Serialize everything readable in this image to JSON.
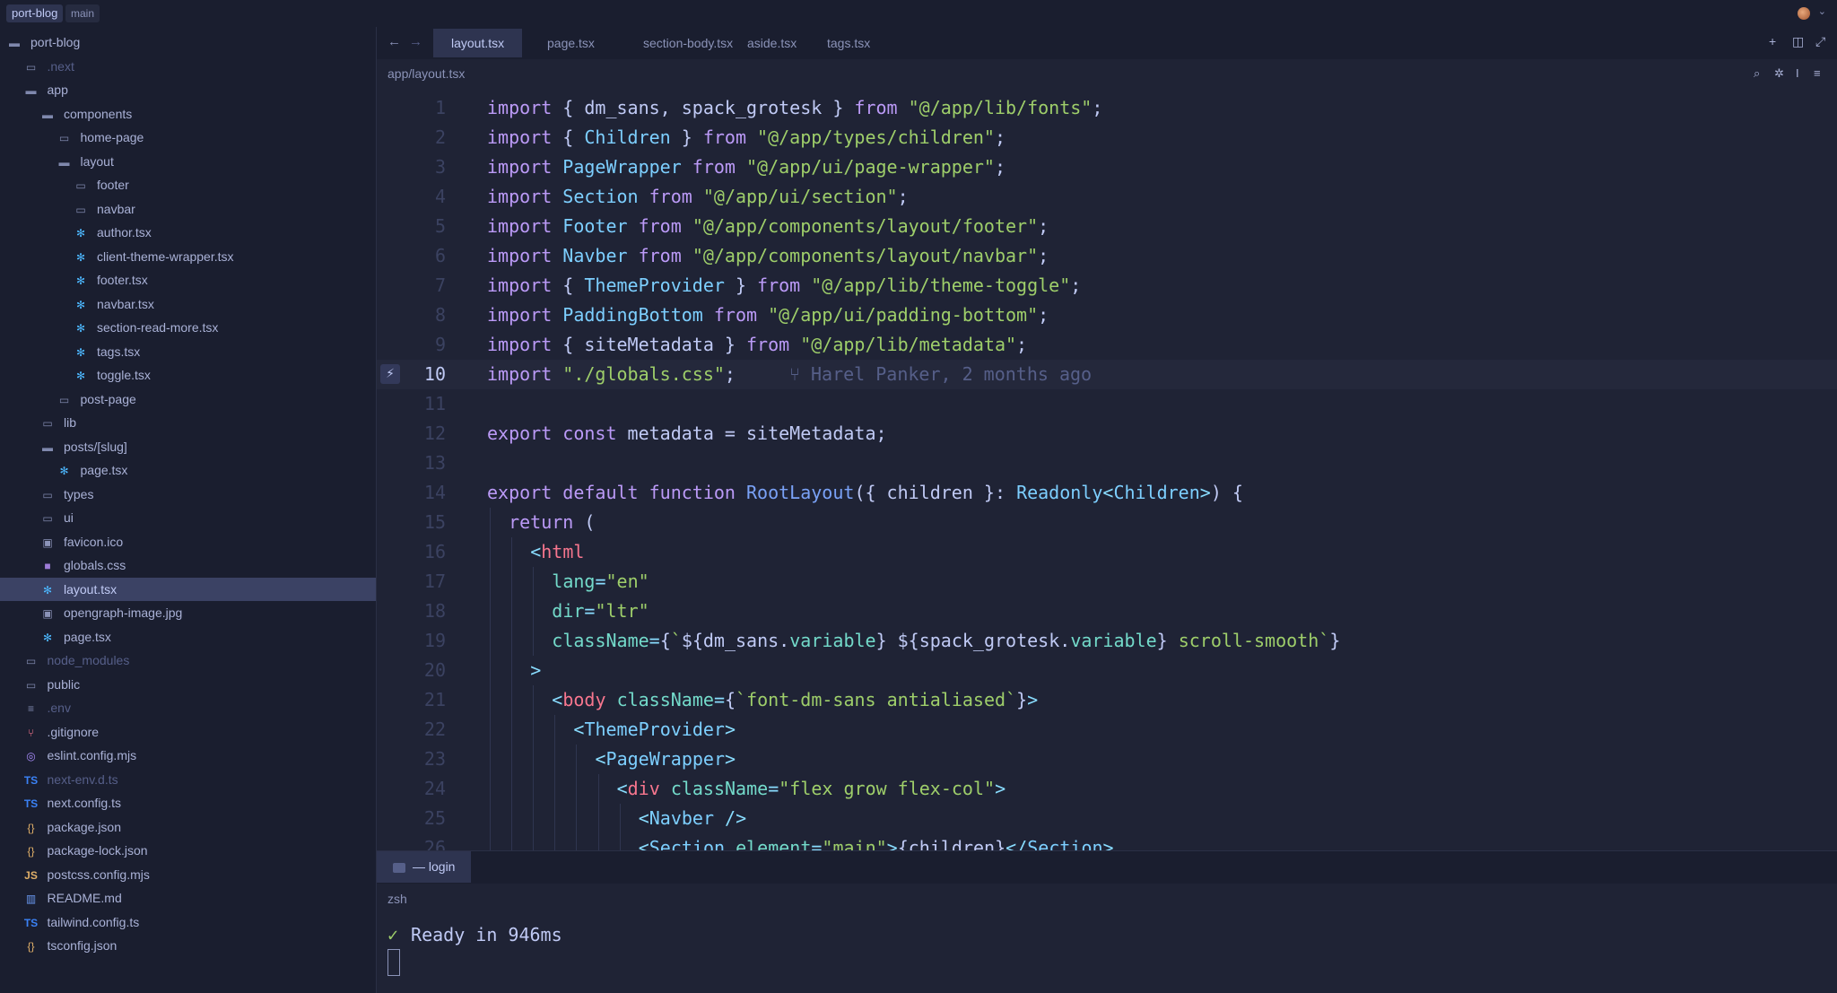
{
  "titlebar": {
    "project": "port-blog",
    "branch": "main"
  },
  "sidebar": {
    "items": [
      {
        "label": "port-blog",
        "icon": "folder-open-icon",
        "depth": 0,
        "muted": false
      },
      {
        "label": ".next",
        "icon": "folder-icon",
        "depth": 1,
        "muted": true
      },
      {
        "label": "app",
        "icon": "folder-open-icon",
        "depth": 1,
        "muted": false
      },
      {
        "label": "components",
        "icon": "folder-open-icon",
        "depth": 2,
        "muted": false
      },
      {
        "label": "home-page",
        "icon": "folder-icon",
        "depth": 3,
        "muted": false
      },
      {
        "label": "layout",
        "icon": "folder-open-icon",
        "depth": 3,
        "muted": false
      },
      {
        "label": "footer",
        "icon": "folder-icon",
        "depth": 4,
        "muted": false
      },
      {
        "label": "navbar",
        "icon": "folder-icon",
        "depth": 4,
        "muted": false
      },
      {
        "label": "author.tsx",
        "icon": "react-icon",
        "depth": 4,
        "muted": false
      },
      {
        "label": "client-theme-wrapper.tsx",
        "icon": "react-icon",
        "depth": 4,
        "muted": false
      },
      {
        "label": "footer.tsx",
        "icon": "react-icon",
        "depth": 4,
        "muted": false
      },
      {
        "label": "navbar.tsx",
        "icon": "react-icon",
        "depth": 4,
        "muted": false
      },
      {
        "label": "section-read-more.tsx",
        "icon": "react-icon",
        "depth": 4,
        "muted": false
      },
      {
        "label": "tags.tsx",
        "icon": "react-icon",
        "depth": 4,
        "muted": false
      },
      {
        "label": "toggle.tsx",
        "icon": "react-icon",
        "depth": 4,
        "muted": false
      },
      {
        "label": "post-page",
        "icon": "folder-icon",
        "depth": 3,
        "muted": false
      },
      {
        "label": "lib",
        "icon": "folder-icon",
        "depth": 2,
        "muted": false
      },
      {
        "label": "posts/[slug]",
        "icon": "folder-open-icon",
        "depth": 2,
        "muted": false
      },
      {
        "label": "page.tsx",
        "icon": "react-icon",
        "depth": 3,
        "muted": false
      },
      {
        "label": "types",
        "icon": "folder-icon",
        "depth": 2,
        "muted": false
      },
      {
        "label": "ui",
        "icon": "folder-icon",
        "depth": 2,
        "muted": false
      },
      {
        "label": "favicon.ico",
        "icon": "image-icon",
        "depth": 2,
        "muted": false
      },
      {
        "label": "globals.css",
        "icon": "css-icon",
        "depth": 2,
        "muted": false
      },
      {
        "label": "layout.tsx",
        "icon": "react-icon",
        "depth": 2,
        "muted": false,
        "selected": true
      },
      {
        "label": "opengraph-image.jpg",
        "icon": "image-icon",
        "depth": 2,
        "muted": false
      },
      {
        "label": "page.tsx",
        "icon": "react-icon",
        "depth": 2,
        "muted": false
      },
      {
        "label": "node_modules",
        "icon": "folder-icon",
        "depth": 1,
        "muted": true
      },
      {
        "label": "public",
        "icon": "folder-icon",
        "depth": 1,
        "muted": false
      },
      {
        "label": ".env",
        "icon": "env-icon",
        "depth": 1,
        "muted": true
      },
      {
        "label": ".gitignore",
        "icon": "git-icon",
        "depth": 1,
        "muted": false
      },
      {
        "label": "eslint.config.mjs",
        "icon": "eslint-icon",
        "depth": 1,
        "muted": false
      },
      {
        "label": "next-env.d.ts",
        "icon": "ts-icon",
        "depth": 1,
        "muted": true
      },
      {
        "label": "next.config.ts",
        "icon": "ts-icon",
        "depth": 1,
        "muted": false
      },
      {
        "label": "package.json",
        "icon": "json-icon",
        "depth": 1,
        "muted": false
      },
      {
        "label": "package-lock.json",
        "icon": "json-icon",
        "depth": 1,
        "muted": false
      },
      {
        "label": "postcss.config.mjs",
        "icon": "js-icon",
        "depth": 1,
        "muted": false
      },
      {
        "label": "README.md",
        "icon": "markdown-icon",
        "depth": 1,
        "muted": false
      },
      {
        "label": "tailwind.config.ts",
        "icon": "ts-icon",
        "depth": 1,
        "muted": false
      },
      {
        "label": "tsconfig.json",
        "icon": "json-icon",
        "depth": 1,
        "muted": false
      }
    ]
  },
  "tabs": [
    {
      "label": "layout.tsx",
      "active": true
    },
    {
      "label": "page.tsx",
      "active": false
    },
    {
      "label": "section-body.tsx",
      "active": false
    },
    {
      "label": "aside.tsx",
      "active": false
    },
    {
      "label": "tags.tsx",
      "active": false
    }
  ],
  "editor": {
    "breadcrumb": "app/layout.tsx",
    "current_line": 10,
    "blame": "Harel Panker, 2 months ago",
    "lines": [
      {
        "n": "1",
        "indent": 0,
        "tokens": [
          [
            "kw",
            "import"
          ],
          [
            "plain",
            " { dm_sans, spack_grotesk } "
          ],
          [
            "kw",
            "from"
          ],
          [
            "plain",
            " "
          ],
          [
            "str",
            "\"@/app/lib/fonts\""
          ],
          [
            "plain",
            ";"
          ]
        ]
      },
      {
        "n": "2",
        "indent": 0,
        "tokens": [
          [
            "kw",
            "import"
          ],
          [
            "plain",
            " { "
          ],
          [
            "cls",
            "Children"
          ],
          [
            "plain",
            " } "
          ],
          [
            "kw",
            "from"
          ],
          [
            "plain",
            " "
          ],
          [
            "str",
            "\"@/app/types/children\""
          ],
          [
            "plain",
            ";"
          ]
        ]
      },
      {
        "n": "3",
        "indent": 0,
        "tokens": [
          [
            "kw",
            "import"
          ],
          [
            "plain",
            " "
          ],
          [
            "cls",
            "PageWrapper"
          ],
          [
            "plain",
            " "
          ],
          [
            "kw",
            "from"
          ],
          [
            "plain",
            " "
          ],
          [
            "str",
            "\"@/app/ui/page-wrapper\""
          ],
          [
            "plain",
            ";"
          ]
        ]
      },
      {
        "n": "4",
        "indent": 0,
        "tokens": [
          [
            "kw",
            "import"
          ],
          [
            "plain",
            " "
          ],
          [
            "cls",
            "Section"
          ],
          [
            "plain",
            " "
          ],
          [
            "kw",
            "from"
          ],
          [
            "plain",
            " "
          ],
          [
            "str",
            "\"@/app/ui/section\""
          ],
          [
            "plain",
            ";"
          ]
        ]
      },
      {
        "n": "5",
        "indent": 0,
        "tokens": [
          [
            "kw",
            "import"
          ],
          [
            "plain",
            " "
          ],
          [
            "cls",
            "Footer"
          ],
          [
            "plain",
            " "
          ],
          [
            "kw",
            "from"
          ],
          [
            "plain",
            " "
          ],
          [
            "str",
            "\"@/app/components/layout/footer\""
          ],
          [
            "plain",
            ";"
          ]
        ]
      },
      {
        "n": "6",
        "indent": 0,
        "tokens": [
          [
            "kw",
            "import"
          ],
          [
            "plain",
            " "
          ],
          [
            "cls",
            "Navber"
          ],
          [
            "plain",
            " "
          ],
          [
            "kw",
            "from"
          ],
          [
            "plain",
            " "
          ],
          [
            "str",
            "\"@/app/components/layout/navbar\""
          ],
          [
            "plain",
            ";"
          ]
        ]
      },
      {
        "n": "7",
        "indent": 0,
        "tokens": [
          [
            "kw",
            "import"
          ],
          [
            "plain",
            " { "
          ],
          [
            "cls",
            "ThemeProvider"
          ],
          [
            "plain",
            " } "
          ],
          [
            "kw",
            "from"
          ],
          [
            "plain",
            " "
          ],
          [
            "str",
            "\"@/app/lib/theme-toggle\""
          ],
          [
            "plain",
            ";"
          ]
        ]
      },
      {
        "n": "8",
        "indent": 0,
        "tokens": [
          [
            "kw",
            "import"
          ],
          [
            "plain",
            " "
          ],
          [
            "cls",
            "PaddingBottom"
          ],
          [
            "plain",
            " "
          ],
          [
            "kw",
            "from"
          ],
          [
            "plain",
            " "
          ],
          [
            "str",
            "\"@/app/ui/padding-bottom\""
          ],
          [
            "plain",
            ";"
          ]
        ]
      },
      {
        "n": "9",
        "indent": 0,
        "tokens": [
          [
            "kw",
            "import"
          ],
          [
            "plain",
            " { siteMetadata } "
          ],
          [
            "kw",
            "from"
          ],
          [
            "plain",
            " "
          ],
          [
            "str",
            "\"@/app/lib/metadata\""
          ],
          [
            "plain",
            ";"
          ]
        ]
      },
      {
        "n": "10",
        "indent": 0,
        "tokens": [
          [
            "kw",
            "import"
          ],
          [
            "plain",
            " "
          ],
          [
            "str",
            "\"./globals.css\""
          ],
          [
            "plain",
            ";"
          ]
        ]
      },
      {
        "n": "11",
        "indent": 0,
        "tokens": []
      },
      {
        "n": "12",
        "indent": 0,
        "tokens": [
          [
            "kw",
            "export"
          ],
          [
            "plain",
            " "
          ],
          [
            "kw",
            "const"
          ],
          [
            "plain",
            " metadata = siteMetadata;"
          ]
        ]
      },
      {
        "n": "13",
        "indent": 0,
        "tokens": []
      },
      {
        "n": "14",
        "indent": 0,
        "tokens": [
          [
            "kw",
            "export"
          ],
          [
            "plain",
            " "
          ],
          [
            "kw",
            "default"
          ],
          [
            "plain",
            " "
          ],
          [
            "kw",
            "function"
          ],
          [
            "plain",
            " "
          ],
          [
            "fn",
            "RootLayout"
          ],
          [
            "plain",
            "({ children }: "
          ],
          [
            "cls",
            "Readonly"
          ],
          [
            "punc",
            "<"
          ],
          [
            "cls",
            "Children"
          ],
          [
            "punc",
            ">"
          ],
          [
            "plain",
            ") {"
          ]
        ]
      },
      {
        "n": "15",
        "indent": 1,
        "tokens": [
          [
            "kw",
            "return"
          ],
          [
            "plain",
            " ("
          ]
        ]
      },
      {
        "n": "16",
        "indent": 2,
        "tokens": [
          [
            "punc",
            "<"
          ],
          [
            "tag",
            "html"
          ]
        ]
      },
      {
        "n": "17",
        "indent": 3,
        "tokens": [
          [
            "attr",
            "lang"
          ],
          [
            "punc",
            "="
          ],
          [
            "str",
            "\"en\""
          ]
        ]
      },
      {
        "n": "18",
        "indent": 3,
        "tokens": [
          [
            "attr",
            "dir"
          ],
          [
            "punc",
            "="
          ],
          [
            "str",
            "\"ltr\""
          ]
        ]
      },
      {
        "n": "19",
        "indent": 3,
        "tokens": [
          [
            "attr",
            "className"
          ],
          [
            "punc",
            "="
          ],
          [
            "plain",
            "{"
          ],
          [
            "str",
            "`"
          ],
          [
            "plain",
            "${dm_sans."
          ],
          [
            "attr",
            "variable"
          ],
          [
            "plain",
            "} ${spack_grotesk."
          ],
          [
            "attr",
            "variable"
          ],
          [
            "plain",
            "}"
          ],
          [
            "str",
            " scroll-smooth`"
          ],
          [
            "plain",
            "}"
          ]
        ]
      },
      {
        "n": "20",
        "indent": 2,
        "tokens": [
          [
            "punc",
            ">"
          ]
        ]
      },
      {
        "n": "21",
        "indent": 3,
        "tokens": [
          [
            "punc",
            "<"
          ],
          [
            "tag",
            "body"
          ],
          [
            "plain",
            " "
          ],
          [
            "attr",
            "className"
          ],
          [
            "punc",
            "="
          ],
          [
            "plain",
            "{"
          ],
          [
            "str",
            "`font-dm-sans antialiased`"
          ],
          [
            "plain",
            "}"
          ],
          [
            "punc",
            ">"
          ]
        ]
      },
      {
        "n": "22",
        "indent": 4,
        "tokens": [
          [
            "punc",
            "<"
          ],
          [
            "cls",
            "ThemeProvider"
          ],
          [
            "punc",
            ">"
          ]
        ]
      },
      {
        "n": "23",
        "indent": 5,
        "tokens": [
          [
            "punc",
            "<"
          ],
          [
            "cls",
            "PageWrapper"
          ],
          [
            "punc",
            ">"
          ]
        ]
      },
      {
        "n": "24",
        "indent": 6,
        "tokens": [
          [
            "punc",
            "<"
          ],
          [
            "tag",
            "div"
          ],
          [
            "plain",
            " "
          ],
          [
            "attr",
            "className"
          ],
          [
            "punc",
            "="
          ],
          [
            "str",
            "\"flex grow flex-col\""
          ],
          [
            "punc",
            ">"
          ]
        ]
      },
      {
        "n": "25",
        "indent": 7,
        "tokens": [
          [
            "punc",
            "<"
          ],
          [
            "cls",
            "Navber"
          ],
          [
            "plain",
            " "
          ],
          [
            "punc",
            "/>"
          ]
        ]
      },
      {
        "n": "26",
        "indent": 7,
        "tokens": [
          [
            "punc",
            "<"
          ],
          [
            "cls",
            "Section"
          ],
          [
            "plain",
            " "
          ],
          [
            "attr",
            "element"
          ],
          [
            "punc",
            "="
          ],
          [
            "str",
            "\"main\""
          ],
          [
            "punc",
            ">"
          ],
          [
            "plain",
            "{children}"
          ],
          [
            "punc",
            "</"
          ],
          [
            "cls",
            "Section"
          ],
          [
            "punc",
            ">"
          ]
        ]
      }
    ]
  },
  "terminal": {
    "tab_label": "— login",
    "shell": "zsh",
    "check_mark": "✓",
    "output": "Ready in 946ms"
  }
}
